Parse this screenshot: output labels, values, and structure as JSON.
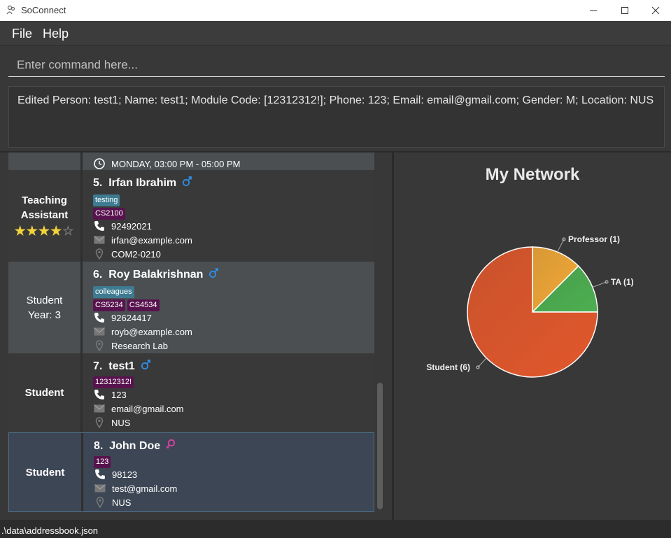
{
  "window": {
    "title": "SoConnect"
  },
  "menu": {
    "items": [
      "File",
      "Help"
    ]
  },
  "command": {
    "placeholder": "Enter command here..."
  },
  "result": {
    "text": "Edited Person: test1; Name: test1; Module Code: [12312312!]; Phone: 123; Email: email@gmail.com; Gender: M; Location: NUS"
  },
  "partial_card": {
    "availability": "MONDAY, 03:00 PM - 05:00 PM"
  },
  "contacts": [
    {
      "index": "5.",
      "name": "Irfan Ibrahim",
      "gender": "male",
      "role_line1": "Teaching",
      "role_line2": "Assistant",
      "rating": 4,
      "rating_max": 5,
      "group_tags": [
        "testing"
      ],
      "module_tags": [
        "CS2100"
      ],
      "phone": "92492021",
      "email": "irfan@example.com",
      "location": "COM2-0210"
    },
    {
      "index": "6.",
      "name": "Roy Balakrishnan",
      "gender": "male",
      "role_line1": "Student",
      "role_line2": "Year: 3",
      "group_tags": [
        "colleagues"
      ],
      "module_tags": [
        "CS5234",
        "CS4534"
      ],
      "phone": "92624417",
      "email": "royb@example.com",
      "location": "Research Lab"
    },
    {
      "index": "7.",
      "name": "test1",
      "gender": "male",
      "role_line1": "Student",
      "role_line2": "",
      "group_tags": [],
      "module_tags": [
        "12312312!"
      ],
      "phone": "123",
      "email": "email@gmail.com",
      "location": "NUS"
    },
    {
      "index": "8.",
      "name": "John Doe",
      "gender": "female",
      "role_line1": "Student",
      "role_line2": "",
      "group_tags": [],
      "module_tags": [
        "123"
      ],
      "phone": "98123",
      "email": "test@gmail.com",
      "location": "NUS"
    }
  ],
  "chart_data": {
    "type": "pie",
    "title": "My Network",
    "categories": [
      "Professor",
      "TA",
      "Student"
    ],
    "values": [
      1,
      1,
      6
    ],
    "labels": [
      "Professor (1)",
      "TA (1)",
      "Student (6)"
    ],
    "colors": [
      "#f3a936",
      "#4caf50",
      "#e2572b"
    ]
  },
  "status": {
    "path": ".\\data\\addressbook.json"
  },
  "colors": {
    "male_icon": "#2f8fe8",
    "female_icon": "#e040a8",
    "group_tag": "#3e7b91",
    "module_tag": "#58134f",
    "selected_card": "#3d4654",
    "card_dark": "#393939",
    "card_light": "#4b4f52"
  }
}
